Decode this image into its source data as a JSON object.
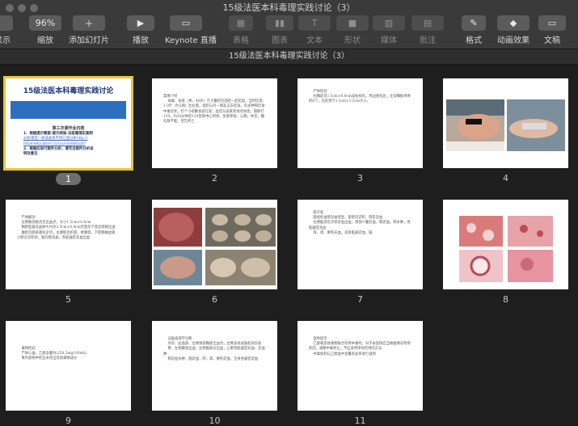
{
  "window": {
    "title": "15级法医本科毒理实践讨论（3）"
  },
  "toolbar": {
    "items": [
      {
        "label": "显示",
        "icon": "view-icon",
        "glyph": "",
        "enabled": true
      },
      {
        "label": "缩放",
        "icon": "zoom-icon",
        "glyph": "96%",
        "enabled": true
      },
      {
        "label": "添加幻灯片",
        "icon": "plus-icon",
        "glyph": "＋",
        "enabled": true
      },
      {
        "label": "播放",
        "icon": "play-icon",
        "glyph": "▶",
        "enabled": true
      },
      {
        "label": "Keynote 直播",
        "icon": "keynote-live-icon",
        "glyph": "▭",
        "enabled": true
      },
      {
        "label": "表格",
        "icon": "table-icon",
        "glyph": "▦",
        "enabled": false
      },
      {
        "label": "图表",
        "icon": "chart-icon",
        "glyph": "▮▮",
        "enabled": false
      },
      {
        "label": "文本",
        "icon": "text-icon",
        "glyph": "T",
        "enabled": false
      },
      {
        "label": "形状",
        "icon": "shape-icon",
        "glyph": "■",
        "enabled": false
      },
      {
        "label": "媒体",
        "icon": "media-icon",
        "glyph": "▨",
        "enabled": false
      },
      {
        "label": "批注",
        "icon": "comment-icon",
        "glyph": "▤",
        "enabled": false
      },
      {
        "label": "格式",
        "icon": "format-brush-icon",
        "glyph": "✎",
        "enabled": true
      },
      {
        "label": "动画效果",
        "icon": "animate-icon",
        "glyph": "◆",
        "enabled": true
      },
      {
        "label": "文稿",
        "icon": "document-icon",
        "glyph": "▭",
        "enabled": true
      }
    ]
  },
  "document_tab": {
    "title": "15级法医本科毒理实践讨论（3）"
  },
  "slides": [
    {
      "number": "1",
      "selected": true,
      "title": "15级法医本科毒理实践讨论",
      "subtitle": "第三次课作业内容",
      "lines": [
        "1、根据提示教案-提示阅读-法医毒理实案例",
        "分析课堂一阅读关系不得它提分析http://",
        "fotomeducation.cn/course/default?",
        "2、根据应进行案件分析，请写出案件分析说",
        "明及意见"
      ]
    },
    {
      "number": "2",
      "text": "案情介绍\n    病毒、张某（男，40岁）在大量的饮酒后一起吃饭，当时饮酒 1.0斤（约2两）左右酒，酒后与另一朋友又去吃饭，有多种和饮食中毒症状，打个小组聚会就在家，饭后与张某到地点休息，随即打120。约20分钟后120急救中心到场，张某呼吸、心跳，休克，瞳孔散不能，宣告死亡"
    },
    {
      "number": "3",
      "text": "    尸体检验\n    右胸前见1.5cm×0.8cm皮肤损伤，周边挫伤区，左前胸肋骨骨折8个，左前颈下1.5cm×1.5cm大小。"
    },
    {
      "number": "4",
      "photo": "clinical-photos"
    },
    {
      "number": "5",
      "text": "    尸体解剖\n    左侧颞部肌肉见出血点，大小1.5cm×0.4cm\n    胸腔脏器充血肿大约达3.5cm×0.4cm范围见下及淤肢稍出血\n    腹腔见肠系膜有淤点，主肠壁也积液，胃肠壁，下腔静脉血管、小肠呈淤积状，脑内增充血，各脏器官充血出血"
    },
    {
      "number": "6",
      "photo": "organ-photos"
    },
    {
      "number": "7",
      "text": "    脑干处\n    脑组织血管淤血明显，管腔内淤积，肺见淤血\n    左侧脑部见点状淤血出血，颈部少量淤血，肺淤血，肺水肿，各脏器官充血\n    肝、肾、脾各充血，其余脏器淤血，脑"
    },
    {
      "number": "8",
      "photo": "histology-photos"
    },
    {
      "number": "9",
      "text": "    毒物检验\n    尸体心血、乙醇含量为(256.2mg/100ml)\n    胃内容物中检出未检出其他毒物成分"
    },
    {
      "number": "10",
      "text": "    法医病理学诊断\n    外伤：右面部、左侧颈部胸部出血点，左侧多处皮肤肌肉伤处\n    胃、左侧颞部出血、左侧脑部分出血，心肺等脏器官充血、淤血肿\n    肺淤血水肿，脑淤血，肝、肾、脾各淤血，全身各器官淤血"
    },
    {
      "number": "11",
      "text": "    案件提示\n    乙醇和其他毒物联合作用中毒时，对于本案例应当根据情况判明死因，酒精中毒死亡，不应采用单纯饮用的方法\n    中毒机制与乙醇血中含量的关系进行说明"
    }
  ],
  "colors": {
    "selection": "#e8c630",
    "toolbar": "#3a3a3a",
    "canvas": "#1e1e1e",
    "accent_blue": "#2c6fc1"
  }
}
